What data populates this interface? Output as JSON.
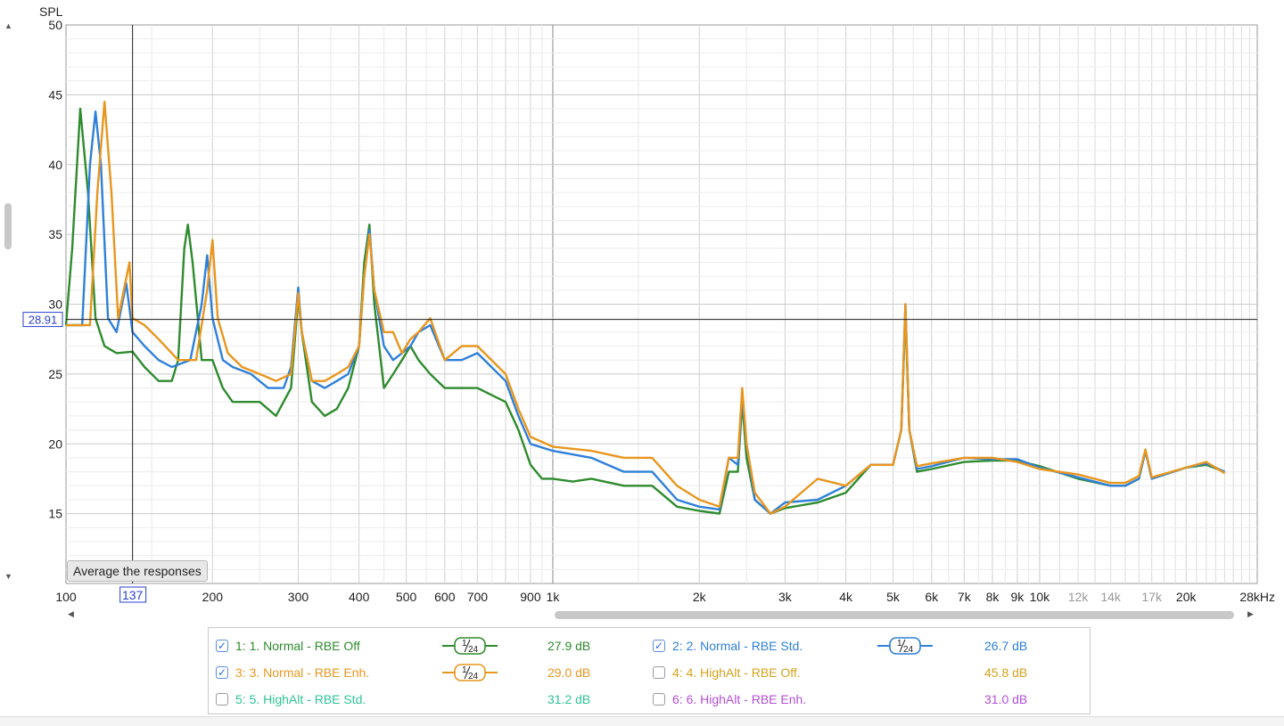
{
  "chart_data": {
    "type": "line",
    "ylabel": "SPL",
    "xunit": "kHz",
    "xscale": "log",
    "xlim": [
      100,
      28000
    ],
    "ylim": [
      10,
      50
    ],
    "yticks": [
      15,
      20,
      25,
      30,
      35,
      40,
      45,
      50
    ],
    "xticks": [
      {
        "v": 100,
        "label": "100"
      },
      {
        "v": 200,
        "label": "200"
      },
      {
        "v": 300,
        "label": "300"
      },
      {
        "v": 400,
        "label": "400"
      },
      {
        "v": 500,
        "label": "500"
      },
      {
        "v": 600,
        "label": "600"
      },
      {
        "v": 700,
        "label": "700"
      },
      {
        "v": 900,
        "label": "900"
      },
      {
        "v": 1000,
        "label": "1k"
      },
      {
        "v": 2000,
        "label": "2k"
      },
      {
        "v": 3000,
        "label": "3k"
      },
      {
        "v": 4000,
        "label": "4k"
      },
      {
        "v": 5000,
        "label": "5k"
      },
      {
        "v": 6000,
        "label": "6k"
      },
      {
        "v": 7000,
        "label": "7k"
      },
      {
        "v": 8000,
        "label": "8k"
      },
      {
        "v": 9000,
        "label": "9k"
      },
      {
        "v": 10000,
        "label": "10k"
      },
      {
        "v": 12000,
        "label": "12k",
        "faded": true
      },
      {
        "v": 14000,
        "label": "14k",
        "faded": true
      },
      {
        "v": 17000,
        "label": "17k",
        "faded": true
      },
      {
        "v": 20000,
        "label": "20k"
      },
      {
        "v": 28000,
        "label": "28kHz"
      }
    ],
    "cursor": {
      "x": 137,
      "y": 28.91,
      "x_label": "137",
      "y_label": "28.91"
    },
    "grid": true,
    "series": [
      {
        "name": "1. Normal - RBE Off",
        "color": "#2e8b2e",
        "points": [
          [
            100,
            28.5
          ],
          [
            103,
            34
          ],
          [
            107,
            44
          ],
          [
            111,
            38
          ],
          [
            115,
            29
          ],
          [
            120,
            27
          ],
          [
            127,
            26.5
          ],
          [
            137,
            26.6
          ],
          [
            145,
            25.5
          ],
          [
            155,
            24.5
          ],
          [
            165,
            24.5
          ],
          [
            170,
            26
          ],
          [
            175,
            34
          ],
          [
            178,
            35.7
          ],
          [
            182,
            33
          ],
          [
            190,
            26
          ],
          [
            200,
            26
          ],
          [
            210,
            24
          ],
          [
            220,
            23
          ],
          [
            250,
            23
          ],
          [
            270,
            22
          ],
          [
            290,
            24
          ],
          [
            300,
            30.5
          ],
          [
            305,
            28
          ],
          [
            320,
            23
          ],
          [
            340,
            22
          ],
          [
            360,
            22.5
          ],
          [
            380,
            24
          ],
          [
            400,
            27
          ],
          [
            410,
            33
          ],
          [
            420,
            35.7
          ],
          [
            430,
            30
          ],
          [
            450,
            24
          ],
          [
            470,
            25
          ],
          [
            490,
            26
          ],
          [
            510,
            27
          ],
          [
            530,
            26
          ],
          [
            560,
            25
          ],
          [
            600,
            24
          ],
          [
            650,
            24
          ],
          [
            700,
            24
          ],
          [
            800,
            23
          ],
          [
            850,
            21
          ],
          [
            900,
            18.5
          ],
          [
            950,
            17.5
          ],
          [
            1000,
            17.5
          ],
          [
            1100,
            17.3
          ],
          [
            1200,
            17.5
          ],
          [
            1400,
            17
          ],
          [
            1600,
            17
          ],
          [
            1800,
            15.5
          ],
          [
            2000,
            15.2
          ],
          [
            2200,
            15
          ],
          [
            2300,
            18
          ],
          [
            2400,
            18
          ],
          [
            2450,
            23
          ],
          [
            2500,
            19
          ],
          [
            2600,
            16
          ],
          [
            2800,
            15
          ],
          [
            3000,
            15.4
          ],
          [
            3500,
            15.8
          ],
          [
            4000,
            16.5
          ],
          [
            4500,
            18.5
          ],
          [
            5000,
            18.5
          ],
          [
            5200,
            21
          ],
          [
            5300,
            29.5
          ],
          [
            5400,
            21
          ],
          [
            5600,
            18
          ],
          [
            6000,
            18.2
          ],
          [
            7000,
            18.7
          ],
          [
            8000,
            18.8
          ],
          [
            9000,
            18.8
          ],
          [
            10000,
            18.4
          ],
          [
            12000,
            17.5
          ],
          [
            14000,
            17
          ],
          [
            15000,
            17
          ],
          [
            16000,
            17.5
          ],
          [
            16500,
            19.5
          ],
          [
            17000,
            17.5
          ],
          [
            20000,
            18.3
          ],
          [
            22000,
            18.5
          ],
          [
            24000,
            18
          ]
        ]
      },
      {
        "name": "2. Normal - RBE Std.",
        "color": "#2f80d8",
        "points": [
          [
            100,
            28.5
          ],
          [
            108,
            28.5
          ],
          [
            112,
            40
          ],
          [
            115,
            43.8
          ],
          [
            118,
            40
          ],
          [
            122,
            29
          ],
          [
            127,
            28
          ],
          [
            133,
            31.5
          ],
          [
            137,
            28
          ],
          [
            145,
            27
          ],
          [
            155,
            26
          ],
          [
            165,
            25.5
          ],
          [
            180,
            26
          ],
          [
            190,
            30
          ],
          [
            195,
            33.5
          ],
          [
            200,
            29
          ],
          [
            210,
            26
          ],
          [
            220,
            25.5
          ],
          [
            240,
            25
          ],
          [
            260,
            24
          ],
          [
            280,
            24
          ],
          [
            290,
            25.5
          ],
          [
            300,
            31.2
          ],
          [
            305,
            28
          ],
          [
            320,
            24.5
          ],
          [
            340,
            24
          ],
          [
            360,
            24.5
          ],
          [
            380,
            25
          ],
          [
            400,
            27
          ],
          [
            410,
            32
          ],
          [
            420,
            35.3
          ],
          [
            430,
            31
          ],
          [
            450,
            27
          ],
          [
            470,
            26
          ],
          [
            490,
            26.5
          ],
          [
            510,
            27
          ],
          [
            530,
            28
          ],
          [
            560,
            28.5
          ],
          [
            600,
            26
          ],
          [
            650,
            26
          ],
          [
            700,
            26.5
          ],
          [
            800,
            24.5
          ],
          [
            850,
            22
          ],
          [
            900,
            20
          ],
          [
            1000,
            19.5
          ],
          [
            1200,
            19
          ],
          [
            1400,
            18
          ],
          [
            1600,
            18
          ],
          [
            1800,
            16
          ],
          [
            2000,
            15.5
          ],
          [
            2200,
            15.3
          ],
          [
            2300,
            19
          ],
          [
            2400,
            18.5
          ],
          [
            2450,
            23.5
          ],
          [
            2500,
            20
          ],
          [
            2600,
            16
          ],
          [
            2800,
            15
          ],
          [
            3000,
            15.8
          ],
          [
            3500,
            16
          ],
          [
            4000,
            17
          ],
          [
            4500,
            18.5
          ],
          [
            5000,
            18.5
          ],
          [
            5200,
            21
          ],
          [
            5300,
            30
          ],
          [
            5400,
            21
          ],
          [
            5600,
            18.2
          ],
          [
            6000,
            18.4
          ],
          [
            7000,
            19
          ],
          [
            8000,
            18.9
          ],
          [
            9000,
            18.9
          ],
          [
            10000,
            18.3
          ],
          [
            12000,
            17.6
          ],
          [
            14000,
            17
          ],
          [
            15000,
            17
          ],
          [
            16000,
            17.5
          ],
          [
            16500,
            19.5
          ],
          [
            17000,
            17.5
          ],
          [
            20000,
            18.3
          ],
          [
            22000,
            18.6
          ],
          [
            24000,
            18
          ]
        ]
      },
      {
        "name": "3. Normal - RBE Enh.",
        "color": "#e8961e",
        "points": [
          [
            100,
            28.5
          ],
          [
            112,
            28.5
          ],
          [
            116,
            38
          ],
          [
            120,
            44.5
          ],
          [
            124,
            38
          ],
          [
            128,
            29
          ],
          [
            135,
            33
          ],
          [
            137,
            29
          ],
          [
            145,
            28.5
          ],
          [
            155,
            27.5
          ],
          [
            170,
            26
          ],
          [
            185,
            26
          ],
          [
            195,
            31
          ],
          [
            200,
            34.6
          ],
          [
            205,
            29
          ],
          [
            215,
            26.5
          ],
          [
            230,
            25.5
          ],
          [
            250,
            25
          ],
          [
            270,
            24.5
          ],
          [
            290,
            25
          ],
          [
            300,
            30.8
          ],
          [
            305,
            28
          ],
          [
            320,
            24.5
          ],
          [
            340,
            24.5
          ],
          [
            360,
            25
          ],
          [
            380,
            25.5
          ],
          [
            400,
            27
          ],
          [
            410,
            32
          ],
          [
            420,
            35
          ],
          [
            430,
            31
          ],
          [
            450,
            28
          ],
          [
            470,
            28
          ],
          [
            490,
            26.5
          ],
          [
            510,
            27.5
          ],
          [
            530,
            28
          ],
          [
            560,
            29
          ],
          [
            600,
            26
          ],
          [
            650,
            27
          ],
          [
            700,
            27
          ],
          [
            800,
            25
          ],
          [
            850,
            22.5
          ],
          [
            900,
            20.5
          ],
          [
            1000,
            19.8
          ],
          [
            1200,
            19.5
          ],
          [
            1400,
            19
          ],
          [
            1600,
            19
          ],
          [
            1800,
            17
          ],
          [
            2000,
            16
          ],
          [
            2200,
            15.5
          ],
          [
            2300,
            19
          ],
          [
            2400,
            19
          ],
          [
            2450,
            24
          ],
          [
            2500,
            20
          ],
          [
            2600,
            16.5
          ],
          [
            2800,
            15
          ],
          [
            3000,
            15.5
          ],
          [
            3500,
            17.5
          ],
          [
            4000,
            17
          ],
          [
            4500,
            18.5
          ],
          [
            5000,
            18.5
          ],
          [
            5200,
            21
          ],
          [
            5300,
            30
          ],
          [
            5400,
            21
          ],
          [
            5600,
            18.4
          ],
          [
            6000,
            18.6
          ],
          [
            7000,
            19
          ],
          [
            8000,
            19
          ],
          [
            9000,
            18.7
          ],
          [
            10000,
            18.2
          ],
          [
            12000,
            17.8
          ],
          [
            14000,
            17.2
          ],
          [
            15000,
            17.2
          ],
          [
            16000,
            17.7
          ],
          [
            16500,
            19.6
          ],
          [
            17000,
            17.6
          ],
          [
            20000,
            18.3
          ],
          [
            22000,
            18.7
          ],
          [
            24000,
            17.9
          ]
        ]
      }
    ]
  },
  "controls": {
    "average_button": "Average the responses"
  },
  "legend": {
    "items": [
      {
        "checked": true,
        "label": "1: 1. Normal - RBE Off",
        "color": "#2e8b2e",
        "smoothing": "1/24",
        "value": "27.9 dB"
      },
      {
        "checked": true,
        "label": "2: 2. Normal - RBE Std.",
        "color": "#2f80d8",
        "smoothing": "1/24",
        "value": "26.7 dB"
      },
      {
        "checked": true,
        "label": "3: 3. Normal - RBE Enh.",
        "color": "#e8961e",
        "smoothing": "1/24",
        "value": "29.0 dB"
      },
      {
        "checked": false,
        "label": "4: 4. HighAlt - RBE Off.",
        "color": "#d3a21c",
        "value": "45.8 dB"
      },
      {
        "checked": false,
        "label": "5: 5. HighAlt - RBE Std.",
        "color": "#2fc49a",
        "value": "31.2 dB"
      },
      {
        "checked": false,
        "label": "6: 6. HighAlt - RBE Enh.",
        "color": "#b34fd8",
        "value": "31.0 dB"
      }
    ]
  }
}
